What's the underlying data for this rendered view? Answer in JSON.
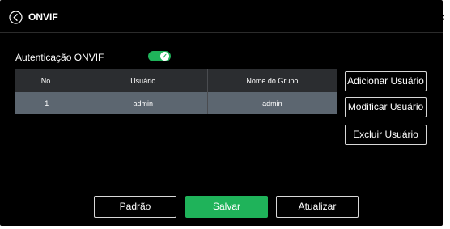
{
  "header": {
    "title": "ONVIF",
    "back_icon": "circle-chevron-left-icon",
    "close_icon": "close-icon",
    "close_glyph": "×"
  },
  "auth": {
    "label": "Autenticação ONVIF",
    "enabled": true,
    "toggle_color": "#1fb35a"
  },
  "table": {
    "headers": {
      "no": "No.",
      "user": "Usuário",
      "group": "Nome do Grupo"
    },
    "rows": [
      {
        "no": "1",
        "user": "admin",
        "group": "admin"
      }
    ]
  },
  "side_buttons": {
    "add": "Adicionar Usuário",
    "modify": "Modificar Usuário",
    "delete": "Excluir Usuário"
  },
  "footer": {
    "default": "Padrão",
    "save": "Salvar",
    "refresh": "Atualizar"
  },
  "colors": {
    "accent": "#1fb35a",
    "background": "#000000",
    "selected_row": "#5c6670"
  }
}
